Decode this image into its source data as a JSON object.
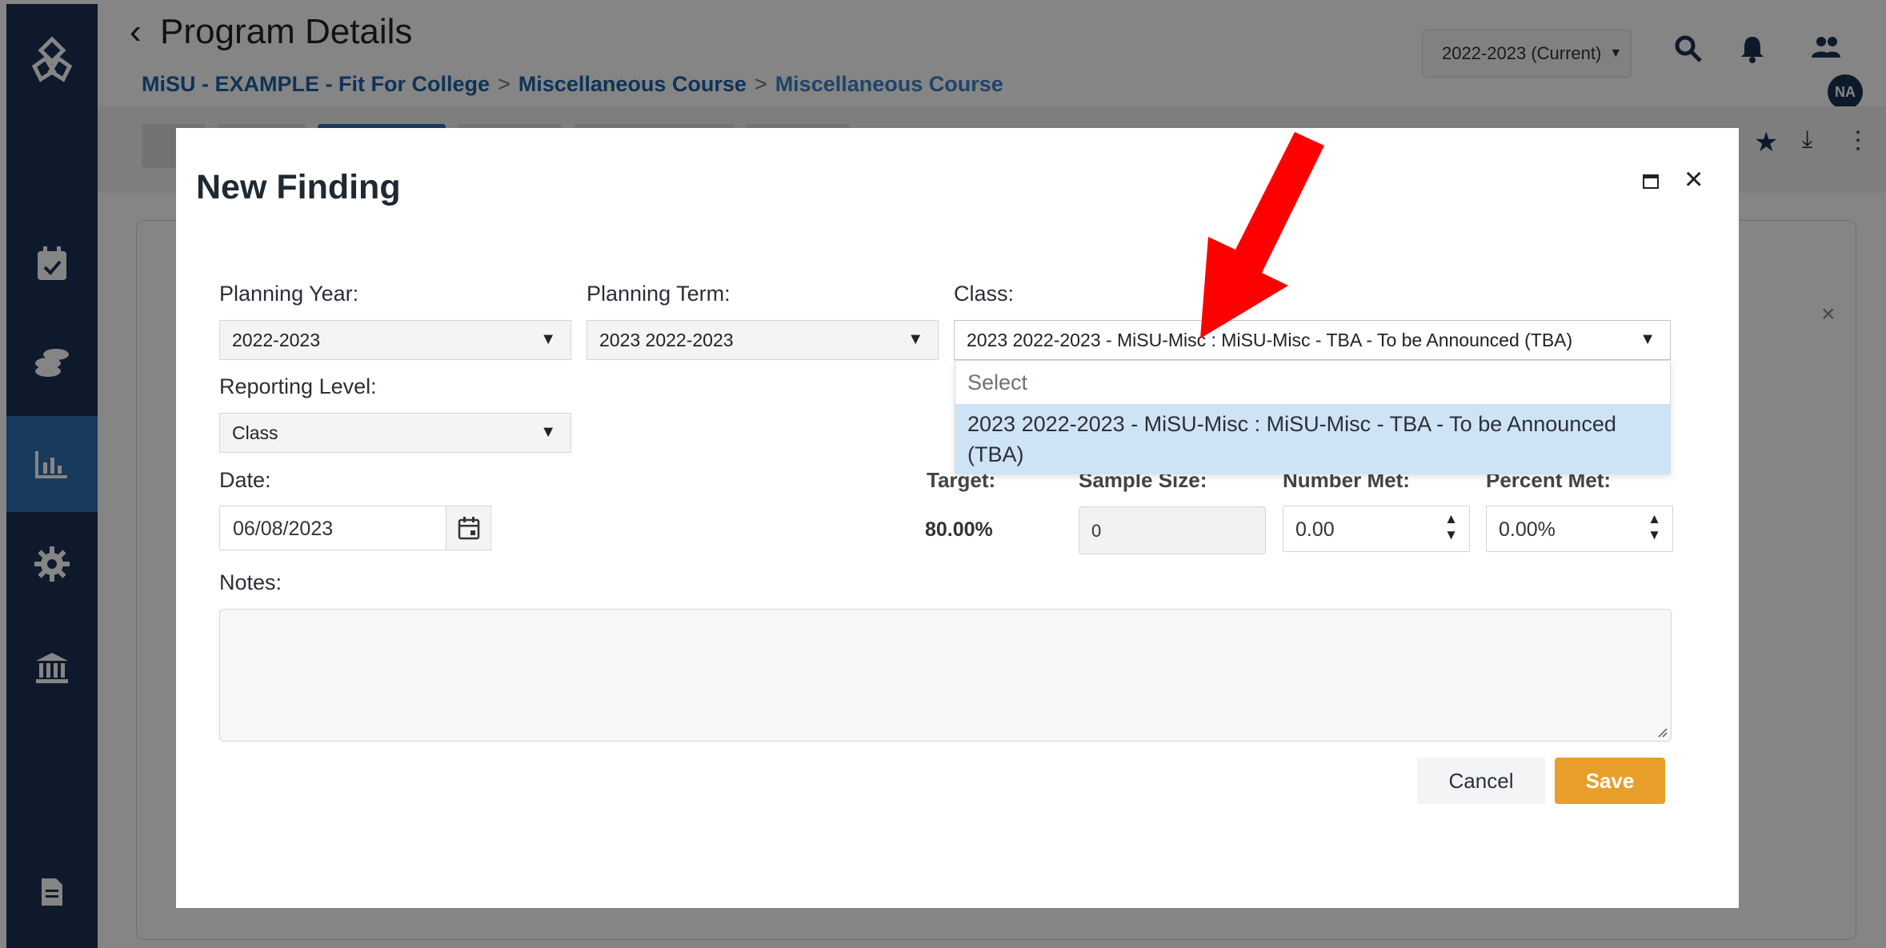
{
  "header": {
    "title": "Program Details",
    "breadcrumb": [
      "MiSU - EXAMPLE - Fit For College",
      "Miscellaneous Course",
      "Miscellaneous Course"
    ],
    "year_selector": "2022-2023 (Current)",
    "avatar_initials": "NA"
  },
  "sidebar": {
    "icons": [
      "logo-icon",
      "calendar-check-icon",
      "coins-icon",
      "chart-icon",
      "gear-icon",
      "institution-icon",
      "document-icon"
    ]
  },
  "modal": {
    "title": "New Finding",
    "fields": {
      "planning_year": {
        "label": "Planning Year:",
        "value": "2022-2023"
      },
      "planning_term": {
        "label": "Planning Term:",
        "value": "2023 2022-2023"
      },
      "class": {
        "label": "Class:",
        "value": "2023 2022-2023 - MiSU-Misc : MiSU-Misc - TBA - To be Announced (TBA)"
      },
      "reporting_level": {
        "label": "Reporting Level:",
        "value": "Class"
      },
      "date": {
        "label": "Date:",
        "value": "06/08/2023"
      },
      "target": {
        "label": "Target:",
        "value": "80.00%"
      },
      "sample_size": {
        "label": "Sample Size:",
        "value": "0"
      },
      "number_met": {
        "label": "Number Met:",
        "value": "0.00"
      },
      "percent_met": {
        "label": "Percent Met:",
        "value": "0.00%"
      },
      "notes": {
        "label": "Notes:",
        "value": ""
      }
    },
    "class_dropdown": {
      "placeholder": "Select",
      "options": [
        "2023 2022-2023 - MiSU-Misc : MiSU-Misc - TBA - To be Announced (TBA)"
      ]
    },
    "buttons": {
      "cancel": "Cancel",
      "save": "Save"
    }
  },
  "colors": {
    "sidebar": "#1c3353",
    "accent": "#1d62a8",
    "save_button": "#e89f2a",
    "dropdown_highlight": "#cfe3f7",
    "annotation_arrow": "#ff0000"
  }
}
